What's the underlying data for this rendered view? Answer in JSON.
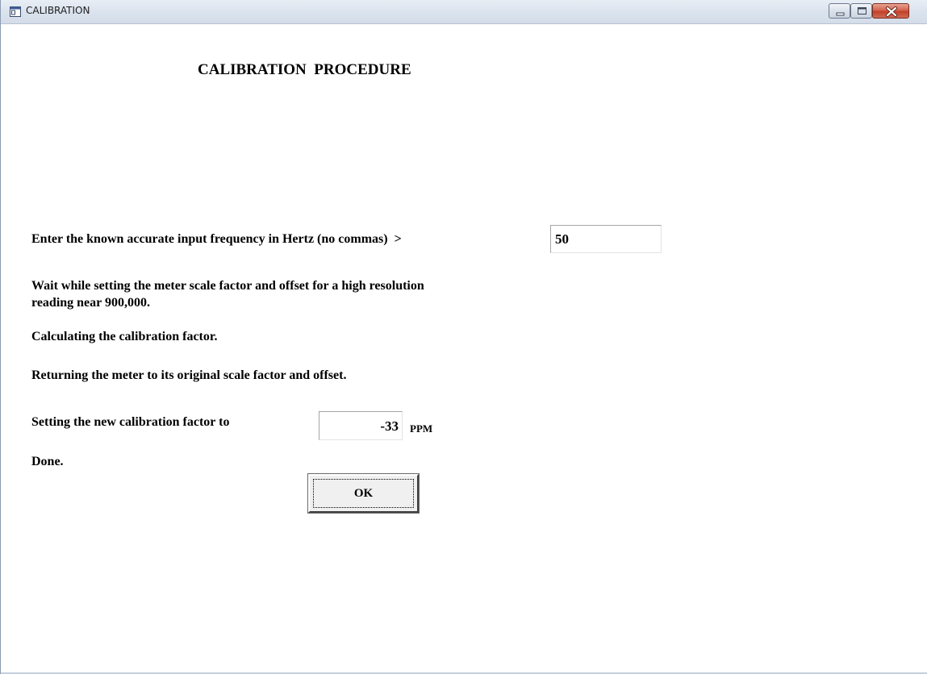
{
  "window": {
    "title": "CALIBRATION"
  },
  "content": {
    "heading": "CALIBRATION  PROCEDURE",
    "frequency_prompt": "Enter the known accurate input frequency in Hertz (no commas)  >",
    "frequency_value": "50",
    "wait_line1": "Wait while setting the meter scale factor and offset for a high resolution",
    "wait_line2": "reading near 900,000.",
    "calculating": "Calculating the calibration factor.",
    "returning": "Returning the meter to its original scale factor and offset.",
    "setting_label": "Setting the new calibration factor to",
    "calibration_value": "-33",
    "calibration_unit": "PPM",
    "done": "Done.",
    "ok_label": "OK"
  },
  "colors": {
    "close_button": "#c2412a",
    "titlebar": "#dbe3ee"
  },
  "icons": {
    "app": "window-app-icon",
    "minimize": "minimize-icon",
    "maximize": "maximize-icon",
    "close": "close-icon"
  }
}
